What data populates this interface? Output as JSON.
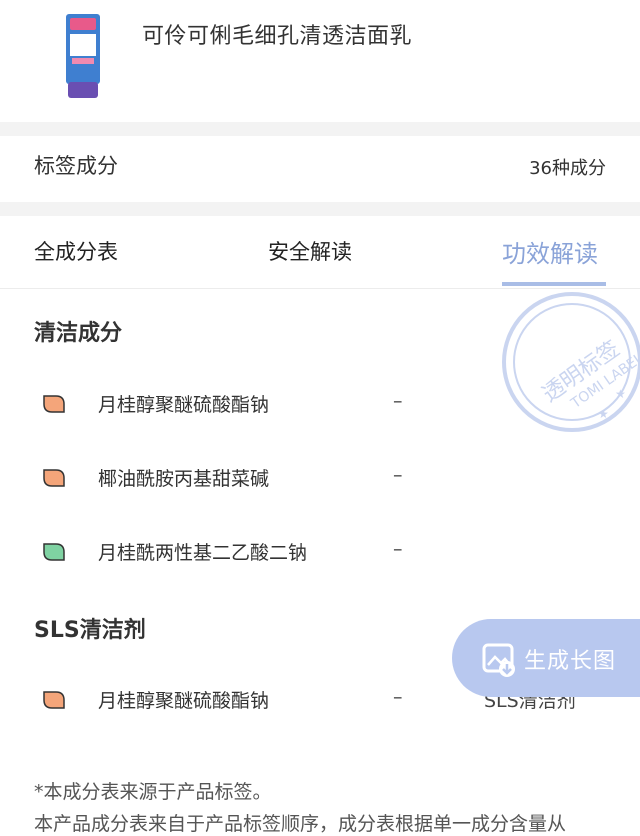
{
  "product": {
    "name": "可伶可俐毛细孔清透洁面乳"
  },
  "label_section": {
    "title": "标签成分",
    "count": "36种成分"
  },
  "tabs": [
    {
      "label": "全成分表",
      "active": false
    },
    {
      "label": "安全解读",
      "active": false
    },
    {
      "label": "功效解读",
      "active": true
    }
  ],
  "sections": [
    {
      "title": "清洁成分",
      "items": [
        {
          "name": "月桂醇聚醚硫酸酯钠",
          "value": "–",
          "tag": "",
          "leaf_color": "#f4a57a"
        },
        {
          "name": "椰油酰胺丙基甜菜碱",
          "value": "–",
          "tag": "",
          "leaf_color": "#f4a57a"
        },
        {
          "name": "月桂酰两性基二乙酸二钠",
          "value": "–",
          "tag": "",
          "leaf_color": "#7fd2a2"
        }
      ]
    },
    {
      "title": "SLS清洁剂",
      "items": [
        {
          "name": "月桂醇聚醚硫酸酯钠",
          "value": "–",
          "tag": "SLS清洁剂",
          "leaf_color": "#f4a57a"
        }
      ]
    }
  ],
  "watermark": {
    "line1": "透明标签",
    "line2": "TOMI LABEL"
  },
  "fab": {
    "label": "生成长图",
    "icon": "image-download-icon"
  },
  "notes": {
    "line1": "*本成分表来源于产品标签。",
    "line2": "本产品成分表来自于产品标签顺序，成分表根据单一成分含量从"
  },
  "colors": {
    "accent": "#8aa3d8",
    "divider": "#f3f3f3",
    "fab": "#b8c8ef"
  }
}
